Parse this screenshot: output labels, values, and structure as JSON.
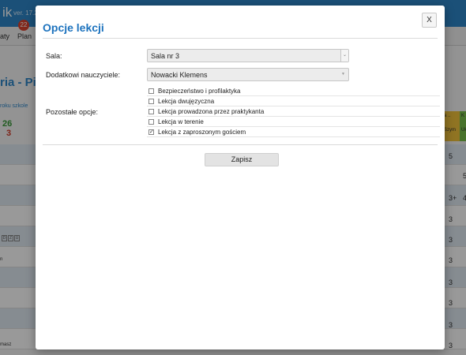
{
  "background": {
    "brand": "ik",
    "version": "ver. 17.2",
    "nav": [
      "aty",
      "Plan"
    ],
    "badge": "22",
    "title": "ria - Pi",
    "subtitle": "roku szkole",
    "num_green": "26",
    "num_red": "3",
    "col_headers": [
      "a ..",
      "K",
      "Szym",
      "Uk"
    ],
    "col_values": [
      "5",
      "5",
      "3+",
      "3",
      "3",
      "3",
      "3",
      "3",
      "3",
      "3"
    ],
    "boxes": [
      "D",
      "Z",
      "U"
    ],
    "row_texts": [
      "n",
      "masz"
    ],
    "side_value": "4"
  },
  "modal": {
    "title": "Opcje lekcji",
    "close_label": "X",
    "room": {
      "label": "Sala:",
      "value": "Sala nr 3"
    },
    "teachers": {
      "label": "Dodatkowi nauczyciele:",
      "value": "Nowacki Klemens"
    },
    "other_options": {
      "label": "Pozostałe opcje:",
      "items": [
        {
          "label": "Bezpieczeństwo i profilaktyka",
          "checked": false
        },
        {
          "label": "Lekcja dwujęzyczna",
          "checked": false
        },
        {
          "label": "Lekcja prowadzona przez praktykanta",
          "checked": false
        },
        {
          "label": "Lekcja w terenie",
          "checked": false
        },
        {
          "label": "Lekcja z zaproszonym gościem",
          "checked": true
        }
      ]
    },
    "save_label": "Zapisz"
  },
  "colors": {
    "accent": "#1d73be",
    "topbar": "#2e86c8",
    "overlay": "rgba(0,0,0,0.40)"
  }
}
